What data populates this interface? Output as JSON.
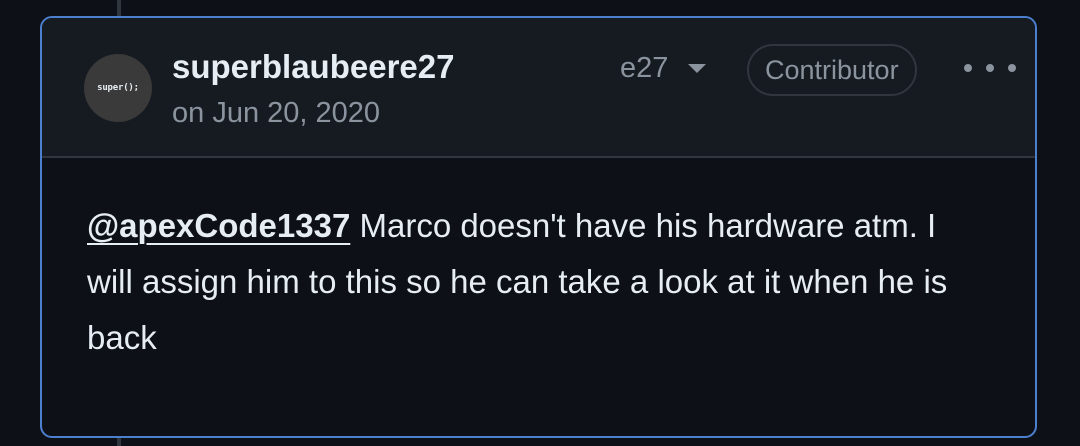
{
  "comment": {
    "avatar_text": "super();",
    "author": "superblaubeere27",
    "timestamp": "on Jun 20, 2020",
    "edited_label": "e27",
    "role_badge": "Contributor",
    "body": {
      "mention": "@apexCode1337",
      "text": " Marco doesn't have his hardware atm. I will assign him to this so he can take a look at it when he is back"
    }
  },
  "icons": {
    "caret": "chevron-down-icon",
    "menu": "kebab-menu-icon"
  },
  "colors": {
    "background": "#0d1117",
    "header_bg": "#161b22",
    "focus_border": "#4c7fd0",
    "muted_text": "#8b949e",
    "primary_text": "#e6edf3"
  }
}
